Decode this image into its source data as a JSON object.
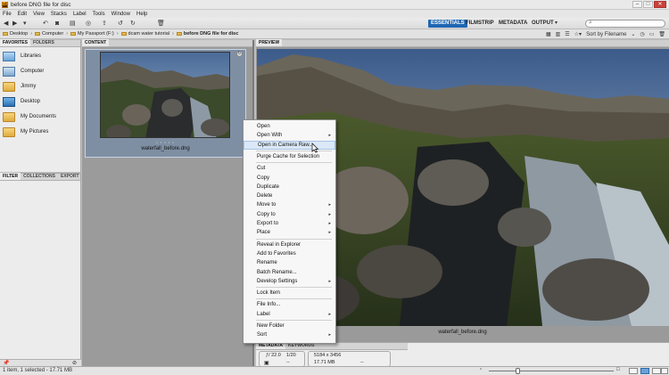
{
  "window": {
    "title": "before DNG file for disc",
    "app_icon": "Br",
    "minimize": "–",
    "maximize": "□",
    "close": "✕"
  },
  "menubar": [
    "File",
    "Edit",
    "View",
    "Stacks",
    "Label",
    "Tools",
    "Window",
    "Help"
  ],
  "toolbar": {
    "workspaces": [
      "ESSENTIALS",
      "FILMSTRIP",
      "METADATA",
      "OUTPUT"
    ],
    "active_workspace": "ESSENTIALS",
    "accent_color": "#1f67b3"
  },
  "path": {
    "crumbs": [
      "Desktop",
      "Computer",
      "My Passport (F:)",
      "dcam water tutorial",
      "before DNG file for disc"
    ],
    "sort_label": "Sort by Filename"
  },
  "favorites": {
    "tabs": [
      "FAVORITES",
      "FOLDERS"
    ],
    "items": [
      "Libraries",
      "Computer",
      "Jimmy",
      "Desktop",
      "My Documents",
      "My Pictures"
    ]
  },
  "filter": {
    "tabs": [
      "FILTER",
      "COLLECTIONS",
      "EXPORT"
    ]
  },
  "content": {
    "tab": "CONTENT",
    "thumbnail_name": "waterfall_before.dng",
    "rating_dots": "• • • • •"
  },
  "preview": {
    "tab": "PREVIEW",
    "caption": "waterfall_before.dng"
  },
  "metadata": {
    "tabs": [
      "METADATA",
      "KEYWORDS"
    ],
    "aperture": "ƒ/ 22.0",
    "shutter": "1/20",
    "dash1": "--",
    "dimensions": "5184 x 3456",
    "filesize": "17.71 MB",
    "dash2": "--"
  },
  "status": {
    "text": "1 item, 1 selected - 17.71 MB"
  },
  "context_menu": {
    "groups": [
      [
        {
          "label": "Open",
          "submenu": false
        },
        {
          "label": "Open With",
          "submenu": true
        },
        {
          "label": "Open in Camera Raw...",
          "submenu": false,
          "highlighted": true
        }
      ],
      [
        {
          "label": "Purge Cache for Selection",
          "submenu": false
        }
      ],
      [
        {
          "label": "Cut",
          "submenu": false
        },
        {
          "label": "Copy",
          "submenu": false
        },
        {
          "label": "Duplicate",
          "submenu": false
        },
        {
          "label": "Delete",
          "submenu": false
        },
        {
          "label": "Move to",
          "submenu": true
        },
        {
          "label": "Copy to",
          "submenu": true
        },
        {
          "label": "Export to",
          "submenu": true
        },
        {
          "label": "Place",
          "submenu": true
        }
      ],
      [
        {
          "label": "Reveal in Explorer",
          "submenu": false
        },
        {
          "label": "Add to Favorites",
          "submenu": false
        },
        {
          "label": "Rename",
          "submenu": false
        },
        {
          "label": "Batch Rename...",
          "submenu": false
        },
        {
          "label": "Develop Settings",
          "submenu": true
        }
      ],
      [
        {
          "label": "Lock Item",
          "submenu": false
        }
      ],
      [
        {
          "label": "File Info...",
          "submenu": false
        },
        {
          "label": "Label",
          "submenu": true
        }
      ],
      [
        {
          "label": "New Folder",
          "submenu": false
        },
        {
          "label": "Sort",
          "submenu": true
        }
      ]
    ],
    "submenu_arrow": "▸"
  }
}
